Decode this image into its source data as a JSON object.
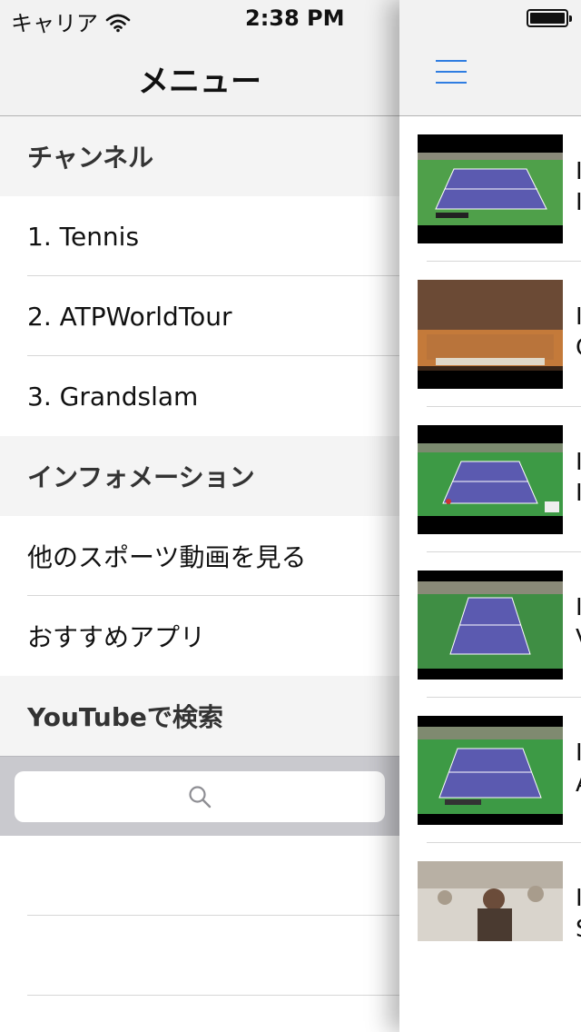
{
  "status_bar": {
    "carrier": "キャリア",
    "time": "2:38 PM"
  },
  "menu": {
    "title": "メニュー",
    "sections": [
      {
        "header": "チャンネル",
        "items": [
          "1. Tennis",
          "2. ATPWorldTour",
          "3. Grandslam"
        ]
      },
      {
        "header": "インフォメーション",
        "items": [
          "他のスポーツ動画を見る",
          "おすすめアプリ"
        ]
      },
      {
        "header": "YouTubeで検索",
        "items": []
      }
    ],
    "search": {
      "placeholder": ""
    }
  },
  "video_list": {
    "items": [
      {
        "thumbnail": "tennis-court-aerial",
        "title_glimpse": [
          "I",
          "I"
        ]
      },
      {
        "thumbnail": "crowded-arena",
        "title_glimpse": [
          "I",
          "C"
        ]
      },
      {
        "thumbnail": "tennis-court-green",
        "title_glimpse": [
          "I",
          "I"
        ]
      },
      {
        "thumbnail": "tennis-court-stadium",
        "title_glimpse": [
          "I",
          "V"
        ]
      },
      {
        "thumbnail": "tennis-court-wide",
        "title_glimpse": [
          "I",
          "A"
        ]
      },
      {
        "thumbnail": "player-closeup",
        "title_glimpse": [
          "I",
          "S"
        ]
      }
    ]
  },
  "colors": {
    "accent": "#2f7de1",
    "navbar_bg": "#f2f2f2",
    "section_bg": "#f4f4f4",
    "search_bar_bg": "#c9c9ce",
    "court_blue": "#5a5ab4",
    "court_green": "#3d9a45"
  }
}
